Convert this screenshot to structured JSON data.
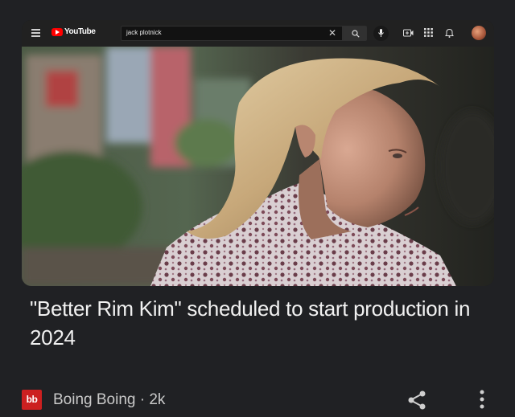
{
  "youtube": {
    "logo_text": "YouTube",
    "search_value": "jack plotnick",
    "clear_symbol": "✕",
    "icons": [
      "menu-icon",
      "search-icon",
      "mic-icon",
      "create-icon",
      "apps-icon",
      "bell-icon",
      "avatar"
    ]
  },
  "article": {
    "title": "\"Better Rim Kim\" scheduled to start production in 2024",
    "source_logo": "bb",
    "source_line": "Boing Boing · 2k"
  },
  "colors": {
    "background": "#202124",
    "brand_red": "#ff0000",
    "bb_red": "#cc2020",
    "title_text": "#f1f1f1"
  }
}
